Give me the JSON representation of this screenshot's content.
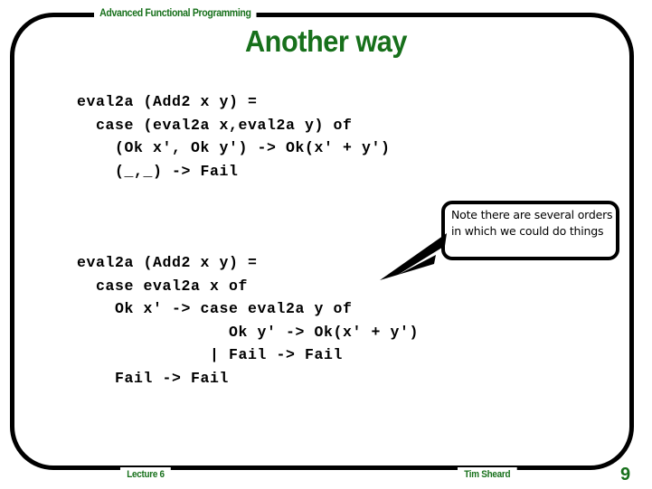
{
  "slide": {
    "header_label": "Advanced Functional Programming",
    "title": "Another way",
    "accent_color": "#17701b",
    "border_color": "#000000",
    "background_color": "#ffffff"
  },
  "code_blocks": [
    {
      "id": "code-block-1",
      "lines": [
        "eval2a (Add2 x y) =",
        "  case (eval2a x,eval2a y) of",
        "    (Ok x', Ok y') -> Ok(x' + y')",
        "    (_,_) -> Fail"
      ]
    },
    {
      "id": "code-block-2",
      "lines": [
        "eval2a (Add2 x y) =",
        "  case eval2a x of",
        "    Ok x' -> case eval2a y of",
        "                Ok y' -> Ok(x' + y')",
        "              | Fail -> Fail",
        "    Fail -> Fail"
      ]
    }
  ],
  "callout": {
    "text": "Note there are several orders in which we could do things"
  },
  "footer": {
    "lecture": "Lecture 6",
    "author": "Tim Sheard",
    "page_number": "9"
  }
}
